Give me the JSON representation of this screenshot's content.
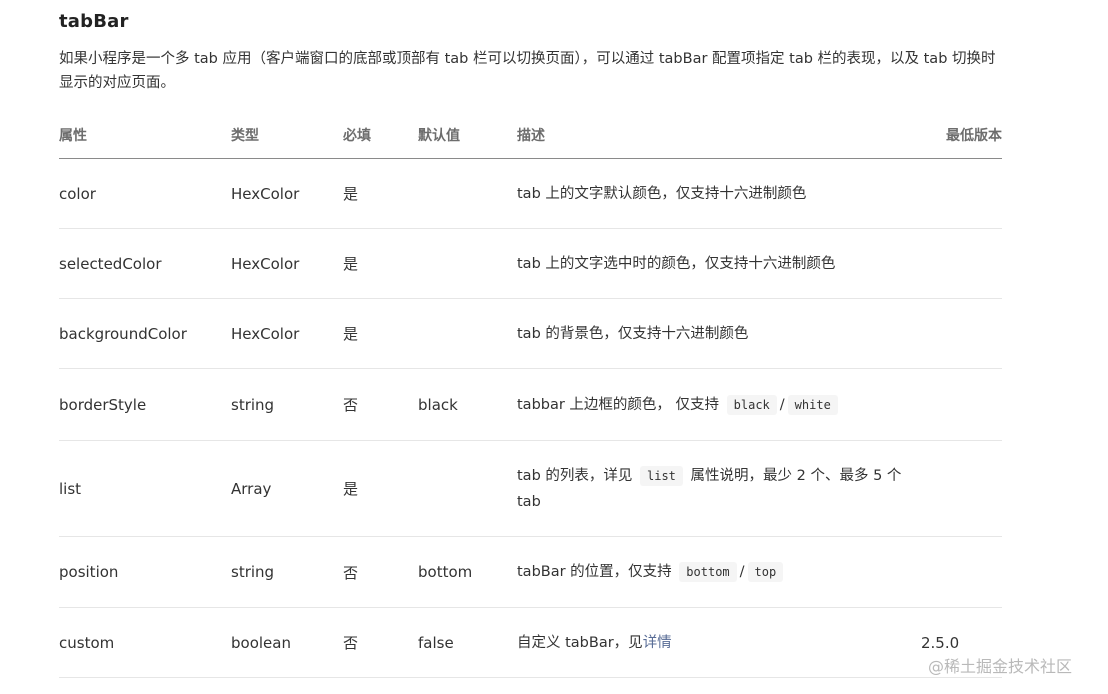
{
  "section": {
    "title": "tabBar",
    "desc_before": "如果小程序是一个多 tab 应用（客户端窗口的底部或顶部有 tab 栏可以切换页面），可以通过 tabBar 配置项指定 tab 栏的表现，以及 tab 切换时显示的对应页面。"
  },
  "table": {
    "headers": [
      "属性",
      "类型",
      "必填",
      "默认值",
      "描述",
      "最低版本"
    ],
    "rows": [
      {
        "name": "color",
        "type": "HexColor",
        "required": "是",
        "default": "",
        "desc": "tab 上的文字默认颜色，仅支持十六进制颜色",
        "version": ""
      },
      {
        "name": "selectedColor",
        "type": "HexColor",
        "required": "是",
        "default": "",
        "desc": "tab 上的文字选中时的颜色，仅支持十六进制颜色",
        "version": ""
      },
      {
        "name": "backgroundColor",
        "type": "HexColor",
        "required": "是",
        "default": "",
        "desc": "tab 的背景色，仅支持十六进制颜色",
        "version": ""
      },
      {
        "name": "borderStyle",
        "type": "string",
        "required": "否",
        "default": "black",
        "desc_a": "tabbar 上边框的颜色， 仅支持",
        "code1": "black",
        "sep": "/",
        "code2": "white",
        "version": ""
      },
      {
        "name": "list",
        "type": "Array",
        "required": "是",
        "default": "",
        "desc_a": "tab 的列表，详见",
        "code1": "list",
        "desc_b": "属性说明，最少 2 个、最多 5 个 tab",
        "version": ""
      },
      {
        "name": "position",
        "type": "string",
        "required": "否",
        "default": "bottom",
        "desc_a": "tabBar 的位置，仅支持",
        "code1": "bottom",
        "sep": "/",
        "code2": "top",
        "version": ""
      },
      {
        "name": "custom",
        "type": "boolean",
        "required": "否",
        "default": "false",
        "desc_a": "自定义 tabBar，见",
        "link": "详情",
        "version": "2.5.0"
      }
    ]
  },
  "watermark": "@稀土掘金技术社区",
  "colors": {
    "link": "#576b95",
    "text": "#333333",
    "header": "#6d6d6d"
  }
}
